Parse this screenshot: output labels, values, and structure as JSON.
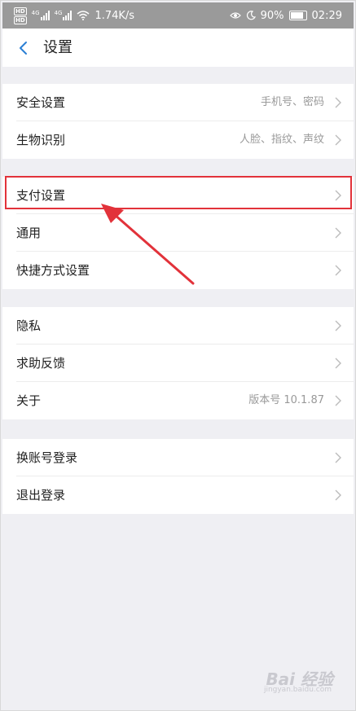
{
  "status_bar": {
    "hd1": "HD",
    "hd2": "HD",
    "net1": "4G",
    "net2": "4G",
    "speed": "1.74K/s",
    "battery": "90%",
    "time": "02:29"
  },
  "header": {
    "title": "设置",
    "back_icon": "chevron-left-icon"
  },
  "sections": [
    [
      {
        "label": "安全设置",
        "value": "手机号、密码"
      },
      {
        "label": "生物识别",
        "value": "人脸、指纹、声纹"
      }
    ],
    [
      {
        "label": "支付设置",
        "value": ""
      },
      {
        "label": "通用",
        "value": ""
      },
      {
        "label": "快捷方式设置",
        "value": ""
      }
    ],
    [
      {
        "label": "隐私",
        "value": ""
      },
      {
        "label": "求助反馈",
        "value": ""
      },
      {
        "label": "关于",
        "value": "版本号 10.1.87"
      }
    ],
    [
      {
        "label": "换账号登录",
        "value": ""
      },
      {
        "label": "退出登录",
        "value": ""
      }
    ]
  ],
  "colors": {
    "accent": "#2a7fd4",
    "highlight": "#e2323a",
    "background": "#efeff3"
  },
  "watermark": {
    "brand": "Bai 经验",
    "url": "jingyan.baidu.com"
  }
}
